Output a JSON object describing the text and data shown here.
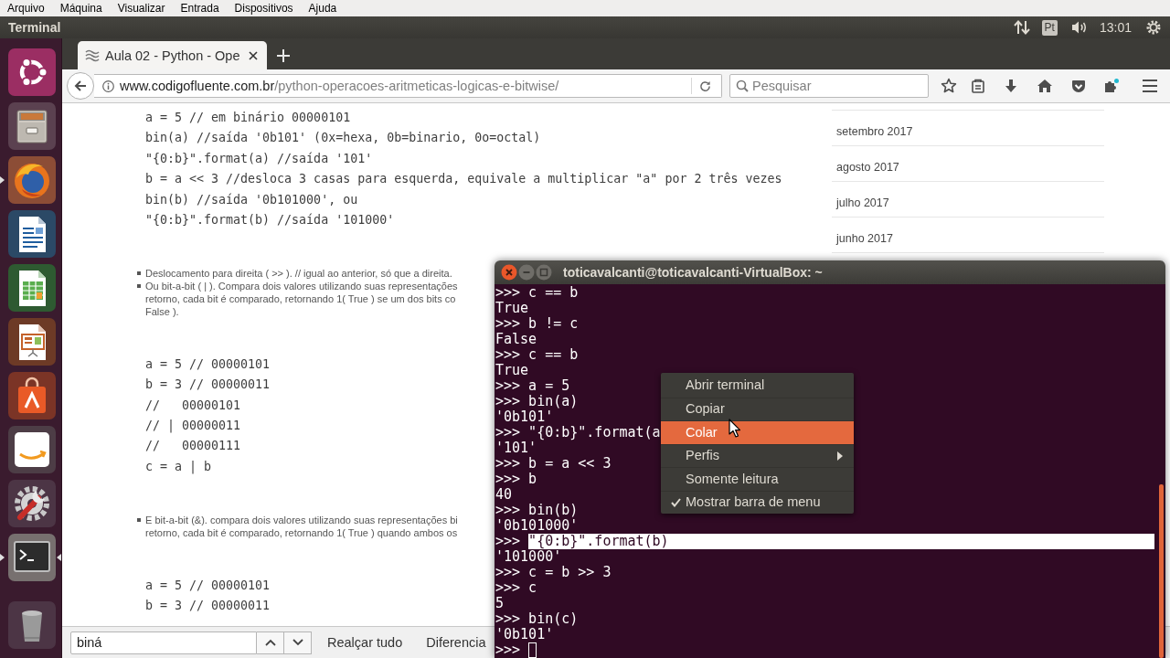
{
  "vm_menu": [
    "Arquivo",
    "Máquina",
    "Visualizar",
    "Entrada",
    "Dispositivos",
    "Ajuda"
  ],
  "top_panel": {
    "title": "Terminal",
    "keyboard": "Pt",
    "clock": "13:01"
  },
  "launcher": [
    {
      "kind": "dash",
      "running": false,
      "focused": false
    },
    {
      "kind": "files",
      "running": false,
      "focused": false
    },
    {
      "kind": "firefox",
      "running": true,
      "focused": false
    },
    {
      "kind": "writer",
      "running": false,
      "focused": false
    },
    {
      "kind": "calc",
      "running": false,
      "focused": false
    },
    {
      "kind": "impress",
      "running": false,
      "focused": false
    },
    {
      "kind": "software",
      "running": false,
      "focused": false
    },
    {
      "kind": "amazon",
      "running": false,
      "focused": false
    },
    {
      "kind": "settings",
      "running": false,
      "focused": false
    },
    {
      "kind": "terminal",
      "running": true,
      "focused": true
    },
    {
      "kind": "trash",
      "running": false,
      "focused": false
    }
  ],
  "browser": {
    "tabs": [
      {
        "title": "Aula 02 - Python - Ope",
        "selected": true
      }
    ],
    "address": {
      "domain": "www.codigofluente.com.br",
      "path": "/python-operacoes-aritmeticas-logicas-e-bitwise/"
    },
    "search": {
      "placeholder": "Pesquisar"
    },
    "content": [
      {
        "kind": "code",
        "lines": [
          "a = 5 // em binário 00000101",
          "bin(a) //saída '0b101' (0x=hexa, 0b=binario, 0o=octal)",
          "\"{0:b}\".format(a) //saída '101'",
          "b = a << 3 //desloca 3 casas para esquerda, equivale a multiplicar \"a\" por 2 três vezes",
          "bin(b) //saída '0b101000', ou",
          "\"{0:b}\".format(b) //saída '101000'"
        ]
      },
      {
        "kind": "bullets",
        "items": [
          {
            "lines": [
              "Deslocamento para direita ( >> ). // igual ao anterior, só que a direita."
            ]
          },
          {
            "lines": [
              "Ou bit-a-bit ( | ). Compara dois valores utilizando suas representações",
              "retorno, cada bit é comparado, retornando 1( True ) se um dos bits co",
              "False )."
            ]
          }
        ]
      },
      {
        "kind": "code",
        "lines": [
          "a = 5 // 00000101",
          "b = 3 // 00000011",
          "//   00000101",
          "// | 00000011",
          "//   00000111",
          "c = a | b"
        ]
      },
      {
        "kind": "bullets",
        "items": [
          {
            "lines": [
              "E bit-a-bit (&). compara dois valores utilizando suas representações bi",
              "retorno, cada bit é comparado, retornando 1( True ) quando ambos os"
            ]
          }
        ]
      },
      {
        "kind": "code",
        "lines": [
          "a = 5 // 00000101",
          "b = 3 // 00000011"
        ]
      }
    ],
    "archive": [
      "setembro 2017",
      "agosto 2017",
      "julho 2017",
      "junho 2017"
    ],
    "find_bar": {
      "value": "biná",
      "options": [
        "Realçar tudo",
        "Diferencia"
      ]
    }
  },
  "terminal": {
    "title": "toticavalcanti@toticavalcanti-VirtualBox: ~",
    "lines": [
      {
        "kind": "input",
        "prompt": ">>>",
        "text": "c == b",
        "selected": false
      },
      {
        "kind": "output",
        "text": "True",
        "selected": false
      },
      {
        "kind": "input",
        "prompt": ">>>",
        "text": "b != c",
        "selected": false
      },
      {
        "kind": "output",
        "text": "False",
        "selected": false
      },
      {
        "kind": "input",
        "prompt": ">>>",
        "text": "c == b",
        "selected": false
      },
      {
        "kind": "output",
        "text": "True",
        "selected": false
      },
      {
        "kind": "input",
        "prompt": ">>>",
        "text": "a = 5",
        "selected": false
      },
      {
        "kind": "input",
        "prompt": ">>>",
        "text": "bin(a)",
        "selected": false
      },
      {
        "kind": "output",
        "text": "'0b101'",
        "selected": false
      },
      {
        "kind": "input",
        "prompt": ">>>",
        "text": "\"{0:b}\".format(a",
        "selected": false
      },
      {
        "kind": "output",
        "text": "'101'",
        "selected": false
      },
      {
        "kind": "input",
        "prompt": ">>>",
        "text": "b = a << 3",
        "selected": false
      },
      {
        "kind": "input",
        "prompt": ">>>",
        "text": "b",
        "selected": false
      },
      {
        "kind": "output",
        "text": "40",
        "selected": false
      },
      {
        "kind": "input",
        "prompt": ">>>",
        "text": "bin(b)",
        "selected": false
      },
      {
        "kind": "output",
        "text": "'0b101000'",
        "selected": false
      },
      {
        "kind": "input",
        "prompt": ">>>",
        "text": "\"{0:b}\".format(b)",
        "selected": true
      },
      {
        "kind": "output",
        "text": "'101000'",
        "selected": false
      },
      {
        "kind": "input",
        "prompt": ">>>",
        "text": "c = b >> 3",
        "selected": false
      },
      {
        "kind": "input",
        "prompt": ">>>",
        "text": "c",
        "selected": false
      },
      {
        "kind": "output",
        "text": "5",
        "selected": false
      },
      {
        "kind": "input",
        "prompt": ">>>",
        "text": "bin(c)",
        "selected": false
      },
      {
        "kind": "output",
        "text": "'0b101'",
        "selected": false
      }
    ],
    "prompt": ">>>",
    "cursor": true,
    "menu": [
      {
        "label": "Abrir terminal",
        "selected": false,
        "checked": false,
        "submenu": false
      },
      {
        "label": "Copiar",
        "selected": false,
        "checked": false,
        "submenu": false
      },
      {
        "label": "Colar",
        "selected": true,
        "checked": false,
        "submenu": false
      },
      {
        "label": "Perfis",
        "selected": false,
        "checked": false,
        "submenu": true
      },
      {
        "label": "Somente leitura",
        "selected": false,
        "checked": false,
        "submenu": false
      },
      {
        "label": "Mostrar barra de menu",
        "selected": false,
        "checked": true,
        "submenu": false
      }
    ]
  }
}
